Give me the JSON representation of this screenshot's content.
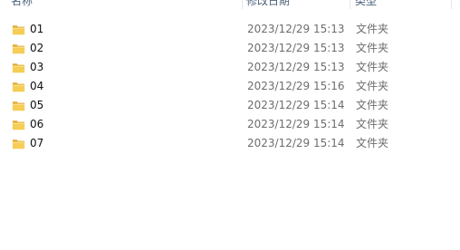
{
  "columns": {
    "name": "名称",
    "date_modified": "修改日期",
    "type": "类型"
  },
  "files": [
    {
      "name": "01",
      "date": "2023/12/29 15:13",
      "type": "文件夹",
      "icon": "folder-icon"
    },
    {
      "name": "02",
      "date": "2023/12/29 15:13",
      "type": "文件夹",
      "icon": "folder-icon"
    },
    {
      "name": "03",
      "date": "2023/12/29 15:13",
      "type": "文件夹",
      "icon": "folder-icon"
    },
    {
      "name": "04",
      "date": "2023/12/29 15:16",
      "type": "文件夹",
      "icon": "folder-icon"
    },
    {
      "name": "05",
      "date": "2023/12/29 15:14",
      "type": "文件夹",
      "icon": "folder-icon"
    },
    {
      "name": "06",
      "date": "2023/12/29 15:14",
      "type": "文件夹",
      "icon": "folder-icon"
    },
    {
      "name": "07",
      "date": "2023/12/29 15:14",
      "type": "文件夹",
      "icon": "folder-icon"
    }
  ],
  "colors": {
    "header_text": "#4c607a",
    "folder_yellow": "#f3c64a",
    "secondary_text": "#6d6d6d"
  }
}
